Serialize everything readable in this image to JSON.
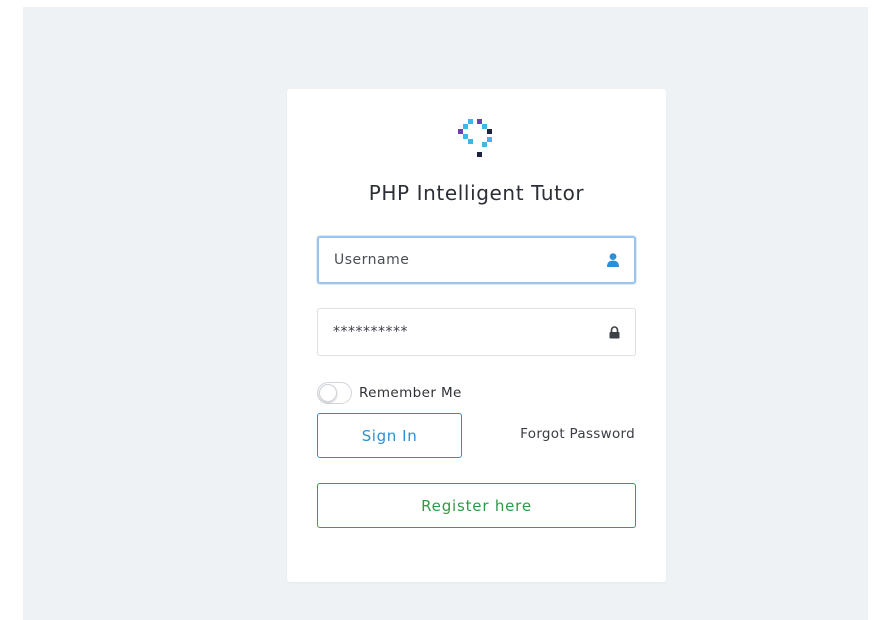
{
  "app": {
    "title": "PHP Intelligent Tutor"
  },
  "login": {
    "username_placeholder": "Username",
    "username_value": "",
    "password_value": "**********",
    "remember_label": "Remember Me",
    "remember_checked": false,
    "sign_in_label": "Sign In",
    "forgot_label": "Forgot Password",
    "register_label": "Register here"
  },
  "icons": {
    "logo": "pixel-diamond-logo",
    "username": "user-icon",
    "password": "lock-icon"
  },
  "colors": {
    "background": "#eef2f5",
    "primary": "#2c8fd6",
    "success": "#36a04b",
    "logo_blue": "#3bb8e8",
    "logo_purple": "#6b3fb5",
    "logo_navy": "#1c2340"
  }
}
